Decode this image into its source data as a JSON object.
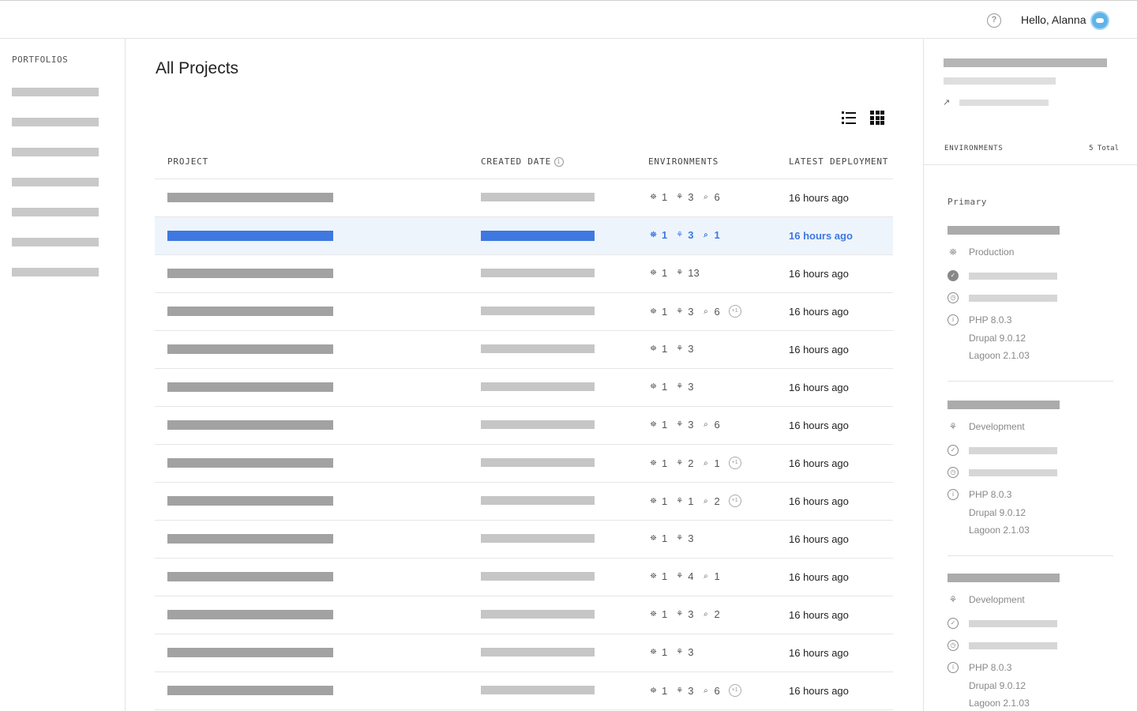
{
  "header": {
    "help_label": "?",
    "greeting": "Hello, Alanna"
  },
  "sidebar": {
    "title": "PORTFOLIOS"
  },
  "main": {
    "title": "All Projects",
    "columns": {
      "project": "PROJECT",
      "created": "CREATED DATE",
      "environments": "ENVIRONMENTS",
      "latest": "LATEST DEPLOYMENT"
    },
    "info_glyph": "i",
    "rows": [
      {
        "envs": [
          "1",
          "3",
          "6"
        ],
        "plus": false,
        "latest": "16 hours ago"
      },
      {
        "envs": [
          "1",
          "3",
          "1"
        ],
        "plus": false,
        "latest": "16 hours ago"
      },
      {
        "envs": [
          "1",
          "13"
        ],
        "plus": false,
        "latest": "16 hours ago"
      },
      {
        "envs": [
          "1",
          "3",
          "6"
        ],
        "plus": true,
        "latest": "16 hours ago"
      },
      {
        "envs": [
          "1",
          "3"
        ],
        "plus": false,
        "latest": "16 hours ago"
      },
      {
        "envs": [
          "1",
          "3"
        ],
        "plus": false,
        "latest": "16 hours ago"
      },
      {
        "envs": [
          "1",
          "3",
          "6"
        ],
        "plus": false,
        "latest": "16 hours ago"
      },
      {
        "envs": [
          "1",
          "2",
          "1"
        ],
        "plus": true,
        "latest": "16 hours ago"
      },
      {
        "envs": [
          "1",
          "1",
          "2"
        ],
        "plus": true,
        "latest": "16 hours ago"
      },
      {
        "envs": [
          "1",
          "3"
        ],
        "plus": false,
        "latest": "16 hours ago"
      },
      {
        "envs": [
          "1",
          "4",
          "1"
        ],
        "plus": false,
        "latest": "16 hours ago"
      },
      {
        "envs": [
          "1",
          "3",
          "2"
        ],
        "plus": false,
        "latest": "16 hours ago"
      },
      {
        "envs": [
          "1",
          "3"
        ],
        "plus": false,
        "latest": "16 hours ago"
      },
      {
        "envs": [
          "1",
          "3",
          "6"
        ],
        "plus": true,
        "latest": "16 hours ago"
      }
    ],
    "plus_label": "+1"
  },
  "details": {
    "env_title": "ENVIRONMENTS",
    "env_total": "5 Total",
    "primary_label": "Primary",
    "environments": [
      {
        "type": "Production",
        "php": "PHP 8.0.3",
        "drupal": "Drupal 9.0.12",
        "lagoon": "Lagoon 2.1.03"
      },
      {
        "type": "Development",
        "php": "PHP 8.0.3",
        "drupal": "Drupal 9.0.12",
        "lagoon": "Lagoon 2.1.03"
      },
      {
        "type": "Development",
        "php": "PHP 8.0.3",
        "drupal": "Drupal 9.0.12",
        "lagoon": "Lagoon 2.1.03"
      }
    ]
  },
  "colors": {
    "accent": "#3e78e0",
    "selected_row_bg": "#eef4fc"
  },
  "icons": {
    "env_production": "production-icon",
    "env_development": "development-icon",
    "env_feature": "feature-icon"
  }
}
